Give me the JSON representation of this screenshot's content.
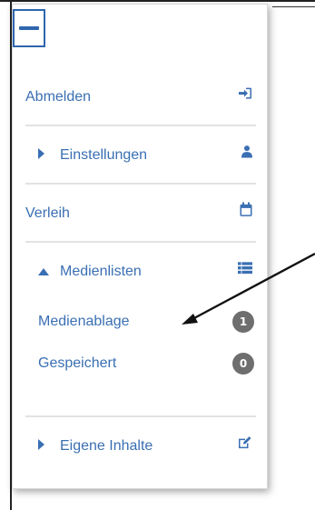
{
  "menu": {
    "items": [
      {
        "label": "Abmelden",
        "icon": "sign-in-icon",
        "expanded": null
      },
      {
        "label": "Einstellungen",
        "icon": "user-icon",
        "expanded": false
      },
      {
        "label": "Verleih",
        "icon": "calendar-icon",
        "expanded": null
      },
      {
        "label": "Medienlisten",
        "icon": "list-icon",
        "expanded": true,
        "children": [
          {
            "label": "Medienablage",
            "count": "1"
          },
          {
            "label": "Gespeichert",
            "count": "0"
          }
        ]
      },
      {
        "label": "Eigene Inhalte",
        "icon": "edit-icon",
        "expanded": false
      }
    ]
  },
  "colors": {
    "accent": "#3a6fb3",
    "badge": "#6e6e6e",
    "divider": "#e2e2e2"
  }
}
